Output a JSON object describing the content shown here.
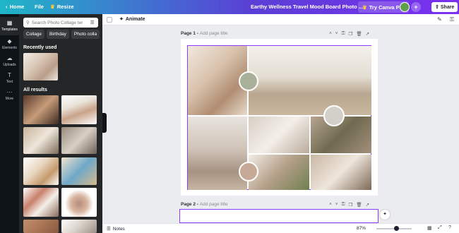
{
  "topbar": {
    "home": "Home",
    "file": "File",
    "resize": "Resize",
    "title": "Earthy Wellness Travel Mood Board Photo ...",
    "try_pro": "Try Canva Pro",
    "plus": "+",
    "share": "Share",
    "gradient": [
      "#1fb6c7",
      "#7b2ff0"
    ]
  },
  "rail": [
    {
      "label": "Templates",
      "icon": "grid-icon"
    },
    {
      "label": "Elements",
      "icon": "shapes-icon"
    },
    {
      "label": "Uploads",
      "icon": "cloud-upload-icon"
    },
    {
      "label": "Text",
      "icon": "text-icon"
    },
    {
      "label": "More",
      "icon": "more-icon"
    }
  ],
  "panel": {
    "search_placeholder": "Search Photo Collage ter",
    "chips": [
      "Collage",
      "Birthday",
      "Photo colla"
    ],
    "recently_used": "Recently used",
    "all_results": "All results"
  },
  "toolbar": {
    "animate": "Animate"
  },
  "canvas": {
    "page1_label": "Page 1 - ",
    "page1_placeholder": "Add page title",
    "page2_label": "Page 2 - ",
    "page2_placeholder": "Add page title",
    "frame_color": "#8b3dff"
  },
  "bottombar": {
    "notes": "Notes",
    "zoom": "87%",
    "zoom_level": 0.87
  }
}
